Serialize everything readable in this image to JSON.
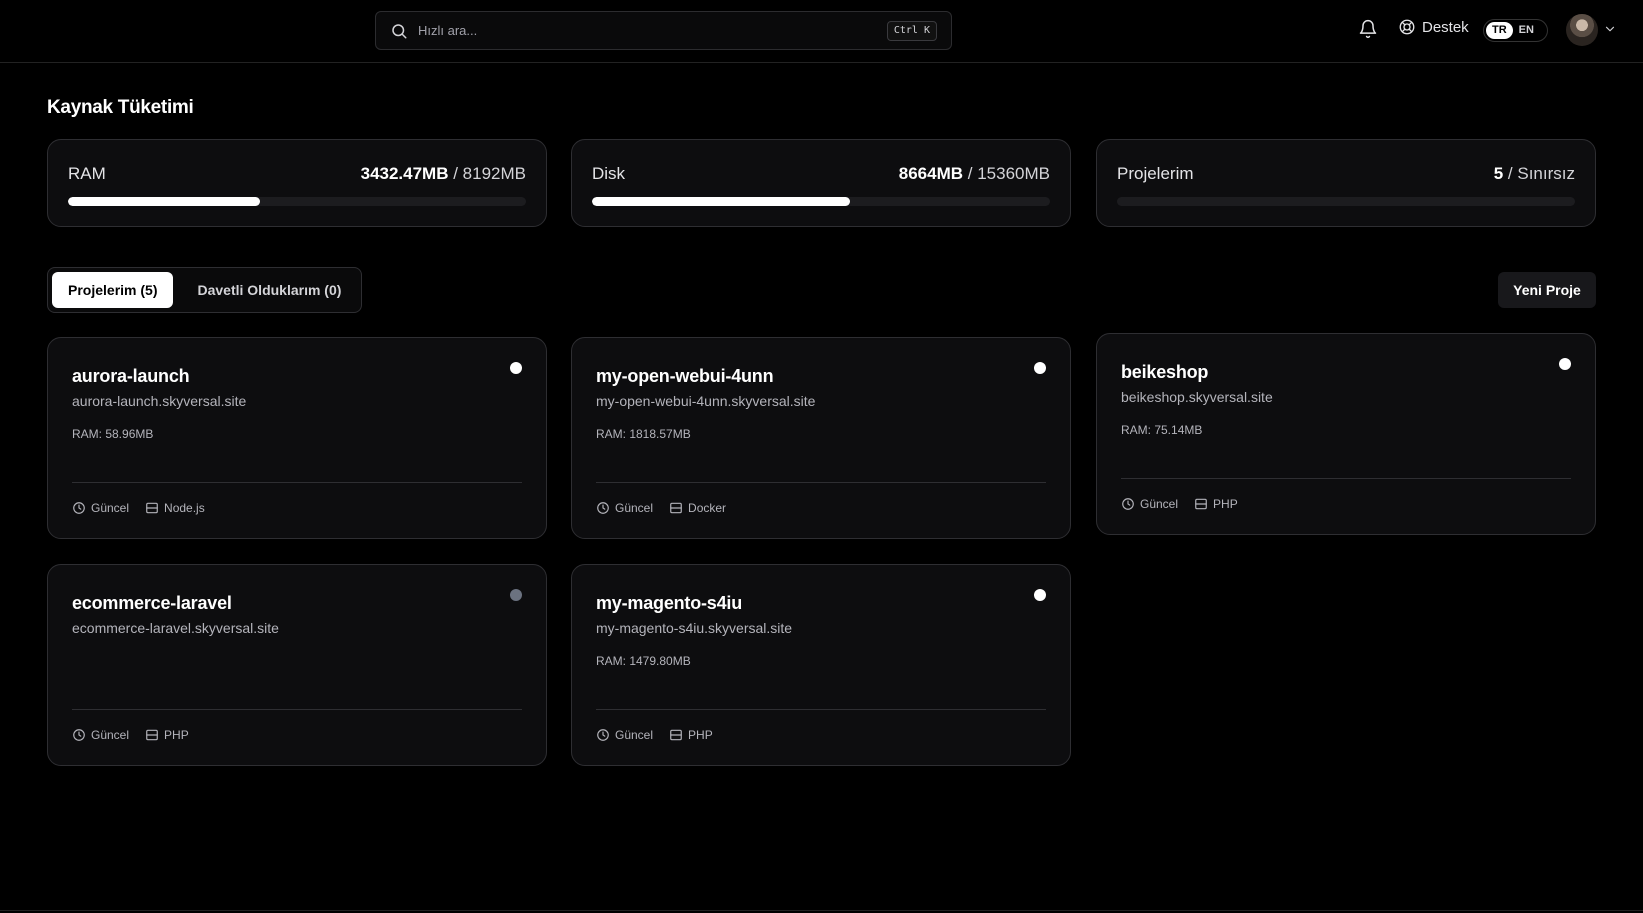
{
  "header": {
    "search_placeholder": "Hızlı ara...",
    "search_shortcut": "Ctrl K",
    "support_label": "Destek",
    "lang_options": [
      "TR",
      "EN"
    ],
    "lang_active": "TR"
  },
  "resources": {
    "title": "Kaynak Tüketimi",
    "ram": {
      "label": "RAM",
      "used": "3432.47MB",
      "total": "/ 8192MB",
      "fraction": 0.419
    },
    "disk": {
      "label": "Disk",
      "used": "8664MB",
      "total": "/ 15360MB",
      "fraction": 0.564
    },
    "projects": {
      "label": "Projelerim",
      "used": "5",
      "total": "/ Sınırsız",
      "fraction": 0
    }
  },
  "tabs": [
    {
      "label": "Projelerim (5)",
      "active": true
    },
    {
      "label": "Davetli Olduklarım (0)",
      "active": false
    }
  ],
  "new_project_label": "Yeni Proje",
  "projects": [
    {
      "name": "aurora-launch",
      "domain": "aurora-launch.skyversal.site",
      "ram": "RAM: 58.96MB",
      "status": "Güncel",
      "runtime": "Node.js",
      "running": true
    },
    {
      "name": "my-open-webui-4unn",
      "domain": "my-open-webui-4unn.skyversal.site",
      "ram": "RAM: 1818.57MB",
      "status": "Güncel",
      "runtime": "Docker",
      "running": true
    },
    {
      "name": "beikeshop",
      "domain": "beikeshop.skyversal.site",
      "ram": "RAM: 75.14MB",
      "status": "Güncel",
      "runtime": "PHP",
      "running": true
    },
    {
      "name": "ecommerce-laravel",
      "domain": "ecommerce-laravel.skyversal.site",
      "ram": "",
      "status": "Güncel",
      "runtime": "PHP",
      "running": false
    },
    {
      "name": "my-magento-s4iu",
      "domain": "my-magento-s4iu.skyversal.site",
      "ram": "RAM: 1479.80MB",
      "status": "Güncel",
      "runtime": "PHP",
      "running": true
    }
  ]
}
